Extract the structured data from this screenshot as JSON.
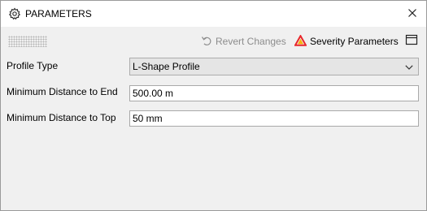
{
  "window": {
    "title": "PARAMETERS"
  },
  "toolbar": {
    "revert_label": "Revert Changes",
    "severity_label": "Severity Parameters"
  },
  "form": {
    "profile_type": {
      "label": "Profile Type",
      "value": "L-Shape Profile"
    },
    "min_distance_end": {
      "label": "Minimum Distance to End",
      "value": "500.00 m"
    },
    "min_distance_top": {
      "label": "Minimum Distance to Top",
      "value": "50 mm"
    }
  },
  "icons": {
    "title": "gear-icon",
    "close": "close-icon",
    "revert": "undo-icon",
    "severity": "warning-triangle-icon",
    "panel": "panel-layout-icon",
    "dropdown": "chevron-down-icon"
  },
  "colors": {
    "window_bg": "#f0f0f0",
    "titlebar_bg": "#ffffff",
    "disabled_text": "#8c8c8c",
    "severity_red": "#e8262b",
    "severity_yellow": "#f6b40e"
  }
}
